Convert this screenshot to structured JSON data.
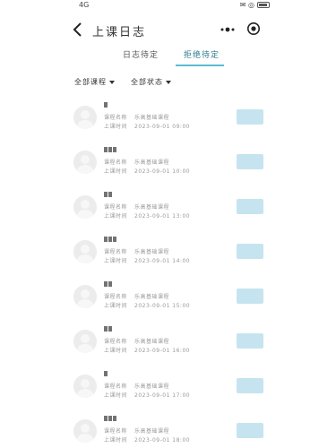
{
  "status_bar": {
    "left": "4G",
    "right": "✉ ◎"
  },
  "nav": {
    "title": "上课日志"
  },
  "tabs": [
    {
      "label": "日志待定"
    },
    {
      "label": "拒绝待定"
    }
  ],
  "filters": [
    {
      "label": "全部课程"
    },
    {
      "label": "全部状态"
    }
  ],
  "row_labels": {
    "course": "课程名称",
    "time": "上课时间"
  },
  "rows": [
    {
      "course_value": "乐高基础课程",
      "time_value": "2023-09-01 09:00"
    },
    {
      "course_value": "乐高基础课程",
      "time_value": "2023-09-01 10:00"
    },
    {
      "course_value": "乐高基础课程",
      "time_value": "2023-09-01 13:00"
    },
    {
      "course_value": "乐高基础课程",
      "time_value": "2023-09-01 14:00"
    },
    {
      "course_value": "乐高基础课程",
      "time_value": "2023-09-01 15:00"
    },
    {
      "course_value": "乐高基础课程",
      "time_value": "2023-09-01 16:00"
    },
    {
      "course_value": "乐高基础课程",
      "time_value": "2023-09-01 17:00"
    },
    {
      "course_value": "乐高基础课程",
      "time_value": "2023-09-01 18:00"
    }
  ],
  "colors": {
    "accent": "#5cbcd2",
    "button": "#c5e4ef"
  },
  "icons": {
    "back": "chevron-left-icon",
    "more": "more-dots-icon",
    "target": "target-icon"
  }
}
